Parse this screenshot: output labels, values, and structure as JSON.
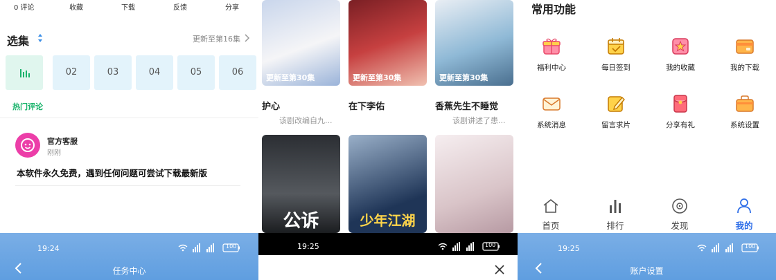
{
  "left": {
    "actions": [
      "0 评论",
      "收藏",
      "下载",
      "反馈",
      "分享"
    ],
    "episodes_title": "选集",
    "episodes_more": "更新至第16集",
    "episodes": [
      "02",
      "03",
      "04",
      "05",
      "06"
    ],
    "hot_comments": "热门评论",
    "comment": {
      "name": "官方客服",
      "time": "刚刚",
      "body": "本软件永久免费，遇到任何问题可尝试下载最新版"
    },
    "status_time": "19:24",
    "battery": "100",
    "bar_title": "任务中心"
  },
  "middle": {
    "posters": [
      {
        "title": "护心",
        "sub": "",
        "label": "更新至第30集",
        "colors": [
          "#b8c9e6",
          "#ffffff"
        ]
      },
      {
        "title": "在下李佑",
        "sub": "该剧改编自九...",
        "label": "更新至第30集",
        "colors": [
          "#c64040",
          "#f0c0b0"
        ]
      },
      {
        "title": "香蕉先生不睡觉",
        "sub": "该剧讲述了患...",
        "label": "更新至第30集",
        "colors": [
          "#8fb9d6",
          "#e8eef4"
        ]
      }
    ],
    "bottom_posters": [
      {
        "mark": "公诉",
        "colors": [
          "#2b2e33",
          "#55595e"
        ]
      },
      {
        "mark": "少年江湖",
        "colors": [
          "#1f3557",
          "#9ab0c9"
        ]
      },
      {
        "mark": "",
        "colors": [
          "#d9c4c8",
          "#f6eef0"
        ]
      }
    ],
    "status_time": "19:25",
    "battery": "100"
  },
  "right": {
    "section_title": "常用功能",
    "features": [
      {
        "label": "福利中心",
        "icon": "gift-icon"
      },
      {
        "label": "每日签到",
        "icon": "calendar-check-icon"
      },
      {
        "label": "我的收藏",
        "icon": "star-icon"
      },
      {
        "label": "我的下载",
        "icon": "download-card-icon"
      },
      {
        "label": "系统消息",
        "icon": "mail-icon"
      },
      {
        "label": "留言求片",
        "icon": "edit-icon"
      },
      {
        "label": "分享有礼",
        "icon": "red-packet-icon"
      },
      {
        "label": "系统设置",
        "icon": "settings-box-icon"
      }
    ],
    "tabs": [
      {
        "label": "首页",
        "icon": "home-icon"
      },
      {
        "label": "排行",
        "icon": "ranking-icon"
      },
      {
        "label": "发现",
        "icon": "discover-icon"
      },
      {
        "label": "我的",
        "icon": "user-icon",
        "active": true
      }
    ],
    "status_time": "19:25",
    "battery": "100",
    "bar_title": "账户设置"
  },
  "colors": {
    "accent_green": "#19b36b",
    "accent_blue": "#2e6ee8",
    "bar_blue": "#6aa6e3",
    "avatar_pink": "#ec3ea8",
    "episode_bg": "#e3f3fb"
  }
}
